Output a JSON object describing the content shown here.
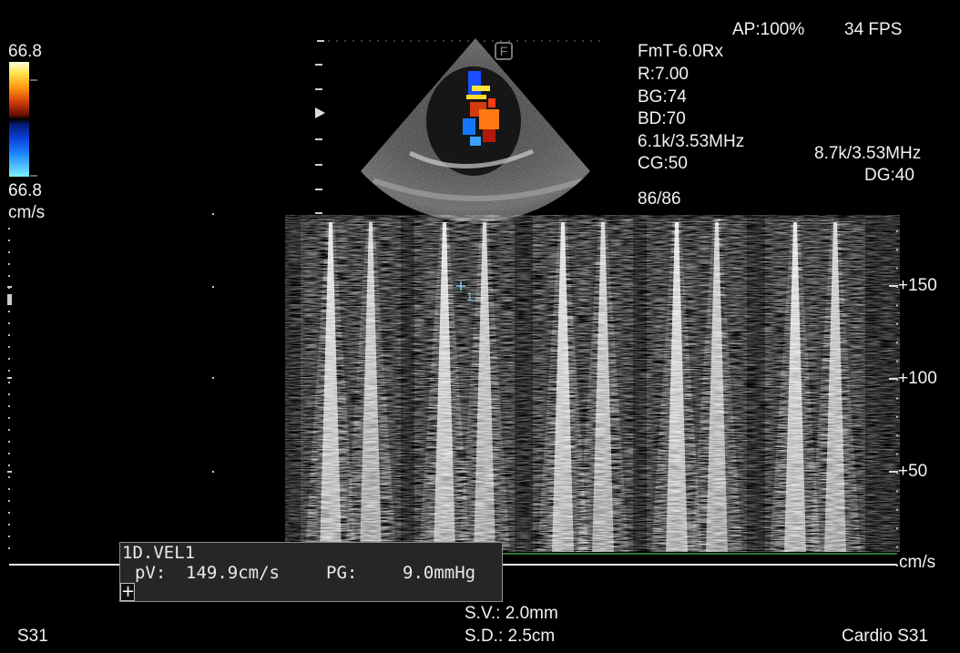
{
  "top_right": {
    "acoustic_power": "AP:100%",
    "frame_rate": "34 FPS"
  },
  "color_scale": {
    "max_label": "66.8",
    "min_label": "66.8",
    "unit": "cm/s"
  },
  "probe_marker": "F",
  "color_params": {
    "preset": "FmT-6.0Rx",
    "r": "R:7.00",
    "bg": "BG:74",
    "bd": "BD:70",
    "prf_freq": "6.1k/3.53MHz",
    "cg": "CG:50",
    "frame_counter": "86/86"
  },
  "doppler_params": {
    "prf_freq": "8.7k/3.53MHz",
    "dg": "DG:40"
  },
  "velocity_axis": {
    "unit": "cm/s",
    "ticks": [
      {
        "label": "+150",
        "value": 150
      },
      {
        "label": "+100",
        "value": 100
      },
      {
        "label": "+50",
        "value": 50
      }
    ],
    "range": [
      0,
      190
    ]
  },
  "cursor_label": "1",
  "measurement": {
    "title": "1D.VEL1",
    "pv_label": "pV:",
    "pv_value": "149.9cm/s",
    "pg_label": "PG:",
    "pg_value": "9.0mmHg",
    "add_symbol": "+"
  },
  "sample_volume": {
    "sv": "S.V.: 2.0mm",
    "sd": "S.D.: 2.5cm"
  },
  "bottom": {
    "left_label": "S31",
    "right_label": "Cardio S31"
  },
  "colors": {
    "background": "#000000",
    "text": "#f2f2f2",
    "baseline": "#3c9a3c",
    "cursor": "#7fd3ff",
    "probe_marker": "#6a6a6a"
  }
}
